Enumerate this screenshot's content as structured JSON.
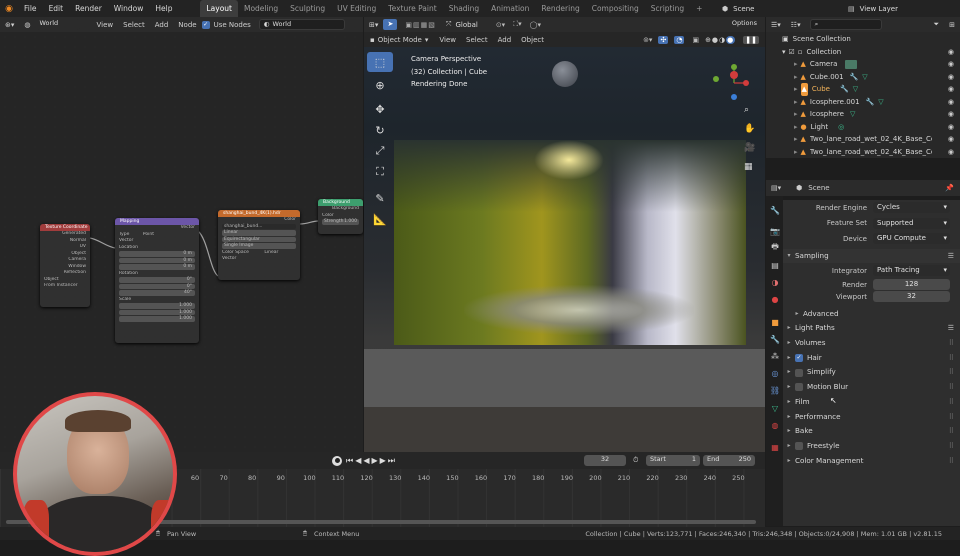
{
  "topbar": {
    "menus": [
      "File",
      "Edit",
      "Render",
      "Window",
      "Help"
    ],
    "workspaces": [
      "Layout",
      "Modeling",
      "Sculpting",
      "UV Editing",
      "Texture Paint",
      "Shading",
      "Animation",
      "Rendering",
      "Compositing",
      "Scripting"
    ],
    "plus": "+",
    "scene": "Scene",
    "view_layer": "View Layer"
  },
  "node_editor": {
    "header": {
      "world_type": "World",
      "view": "View",
      "select": "Select",
      "add": "Add",
      "node": "Node",
      "use_nodes": "Use Nodes",
      "world_name": "World"
    },
    "nodes": {
      "texcoord": {
        "title": "Texture Coordinate",
        "outputs": [
          "Generated",
          "Normal",
          "UV",
          "Object",
          "Camera",
          "Window",
          "Reflection"
        ],
        "object_label": "Object",
        "from_instancer": "From Instancer"
      },
      "mapping": {
        "title": "Mapping",
        "output": "Vector",
        "type_label": "Type",
        "type_value": "Point",
        "vector": "Vector",
        "location": "Location",
        "loc": [
          "0 m",
          "0 m",
          "0 m"
        ],
        "rotation": "Rotation",
        "rot": [
          "0°",
          "0°",
          "40°"
        ],
        "scale": "Scale",
        "scl": [
          "1.000",
          "1.000",
          "1.000"
        ],
        "axes": [
          "X",
          "Y",
          "Z"
        ]
      },
      "envtex": {
        "title": "shanghai_bund_4K(1).hdr",
        "output": "Color",
        "image": "shanghai_bund...",
        "interp": "Linear",
        "proj": "Equirectangular",
        "single": "Single Image",
        "cs_label": "Color Space",
        "cs_value": "Linear",
        "vector": "Vector"
      },
      "background": {
        "title": "Background",
        "output": "Background",
        "color": "Color",
        "strength_label": "Strength",
        "strength_value": "1.000"
      }
    }
  },
  "viewport": {
    "header": {
      "orientation": "Global",
      "options": "Options",
      "mode": "Object Mode",
      "view": "View",
      "select": "Select",
      "add": "Add",
      "object": "Object"
    },
    "overlay": {
      "line1": "Camera Perspective",
      "line2": "(32) Collection | Cube",
      "line3": "Rendering Done"
    }
  },
  "outliner": {
    "header_view_layer": "View Layer",
    "root": "Scene Collection",
    "items": [
      {
        "name": "Collection",
        "icon": "collection-icon"
      },
      {
        "name": "Camera",
        "icon": "camera-icon"
      },
      {
        "name": "Cube.001",
        "icon": "mesh-icon"
      },
      {
        "name": "Cube",
        "icon": "mesh-icon"
      },
      {
        "name": "Icosphere.001",
        "icon": "mesh-icon"
      },
      {
        "name": "Icosphere",
        "icon": "mesh-icon"
      },
      {
        "name": "Light",
        "icon": "light-icon"
      },
      {
        "name": "Two_lane_road_wet_02_4K_Base_Color.0",
        "icon": "image-icon"
      },
      {
        "name": "Two_lane_road_wet_02_4K_Base_Color",
        "icon": "image-icon"
      }
    ]
  },
  "properties": {
    "scene": "Scene",
    "render_engine_label": "Render Engine",
    "render_engine": "Cycles",
    "feature_set_label": "Feature Set",
    "feature_set": "Supported",
    "device_label": "Device",
    "device": "GPU Compute",
    "sampling": "Sampling",
    "integrator_label": "Integrator",
    "integrator": "Path Tracing",
    "render_label": "Render",
    "render_value": "128",
    "viewport_label": "Viewport",
    "viewport_value": "32",
    "advanced": "Advanced",
    "sections": [
      "Light Paths",
      "Volumes",
      "Hair",
      "Simplify",
      "Motion Blur",
      "Film",
      "Performance",
      "Bake",
      "Freestyle",
      "Color Management"
    ]
  },
  "timeline": {
    "current_frame": "32",
    "start_label": "Start",
    "start": "1",
    "end_label": "End",
    "end": "250",
    "ticks": [
      "60",
      "70",
      "80",
      "90",
      "100",
      "110",
      "120",
      "130",
      "140",
      "150",
      "160",
      "170",
      "180",
      "190",
      "200",
      "210",
      "220",
      "230",
      "240",
      "250"
    ]
  },
  "statusbar": {
    "pan": "Pan View",
    "context": "Context Menu",
    "stats": "Collection | Cube | Verts:123,771 | Faces:246,340 | Tris:246,348 | Objects:0/24,908 | Mem: 1.01 GB | v2.81.15"
  },
  "colors": {
    "accent": "#4772b3",
    "node_texcoord": "#a03c3c",
    "node_mapping": "#6c56a8",
    "node_envtex": "#c46a2c",
    "node_background": "#3d9e6e",
    "webcam_ring": "#e04848"
  }
}
